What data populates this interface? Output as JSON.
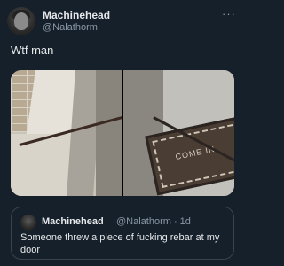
{
  "tweet": {
    "author_name": "Machinehead",
    "author_handle": "@Nalathorm",
    "more_label": "···",
    "text": "Wtf man"
  },
  "media": {
    "left_photo": "photo",
    "right_photo": "photo",
    "mat_text": "COME IN"
  },
  "quoted_tweet": {
    "author_name": "Machinehead",
    "meta": "@Nalathorm · 1d",
    "text": "Someone threw a piece of fucking rebar at my door"
  }
}
